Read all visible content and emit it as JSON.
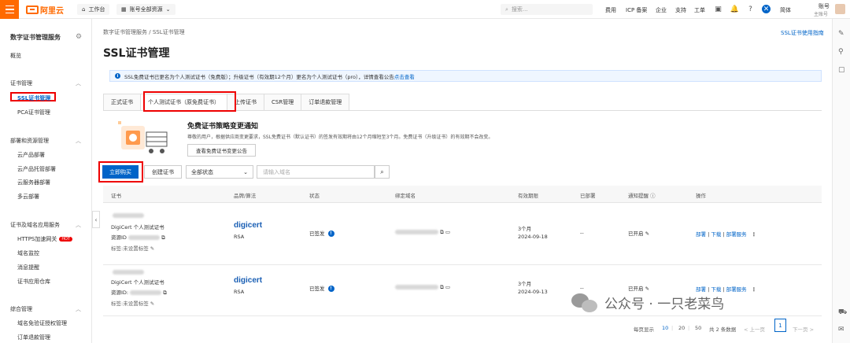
{
  "topbar": {
    "logo_text": "阿里云",
    "workbench": "工作台",
    "account_resources": "账号全部资源",
    "search_placeholder": "搜索...",
    "links": [
      "费用",
      "ICP 备案",
      "企业",
      "支持",
      "工单"
    ],
    "language": "简体",
    "user_name": "账号",
    "user_role": "主账号"
  },
  "sidebar": {
    "title": "数字证书管理服务",
    "overview": "概览",
    "groups": [
      {
        "label": "证书管理",
        "items": [
          "SSL证书管理",
          "PCA证书管理"
        ]
      },
      {
        "label": "部署和资源管理",
        "items": [
          "云产品部署",
          "云产品托管部署",
          "云服务器部署",
          "多云部署"
        ]
      },
      {
        "label": "证书及域名应用服务",
        "items": [
          "HTTPS加速网关",
          "域名监控",
          "消息提醒",
          "证书应用仓库"
        ]
      },
      {
        "label": "综合管理",
        "items": [
          "域名免验证授权管理",
          "订单退款管理"
        ]
      }
    ],
    "hot_badge": "HOT"
  },
  "main": {
    "breadcrumb": [
      "数字证书管理服务",
      "SSL证书管理"
    ],
    "title": "SSL证书管理",
    "guide_link": "SSL证书使用指南",
    "notice_text": "SSL免费证书已更名为个人测试证书（免费版）；升级证书（有效期12个月）更名为个人测试证书（pro），详情查看公告",
    "notice_link": "点击查看",
    "tabs": [
      "正式证书",
      "个人测试证书（原免费证书）",
      "上传证书",
      "CSR管理",
      "订单退款管理"
    ],
    "promo_title": "免费证书策略变更通知",
    "promo_desc": "尊敬的用户，根据供应商变更要求，SSL免费证书（默认证书）的签发有效期将由12个月缩短至3个月。免费证书（升级证书）的有效期不会改变。",
    "promo_button": "查看免费证书变更公告",
    "buy_button": "立即购买",
    "create_button": "创建证书",
    "status_select": "全部状态",
    "domain_placeholder": "请输入域名"
  },
  "table": {
    "headers": [
      "证书",
      "品牌/算法",
      "状态",
      "绑定域名",
      "有效期限",
      "已部署",
      "通知提醒",
      "操作"
    ],
    "rows": [
      {
        "cert_name": "DigiCert 个人测试证书",
        "resource_label": "资源ID",
        "tag_label": "标签:未设置标签",
        "brand": "digicert",
        "algo": "RSA",
        "status": "已签发",
        "validity": "3个月",
        "expiry": "2024-09-18",
        "deployed": "--",
        "notify": "已开启",
        "actions": [
          "部署",
          "下载",
          "部署服务"
        ]
      },
      {
        "cert_name": "DigiCert 个人测试证书",
        "resource_label": "资源ID:",
        "tag_label": "标签:未设置标签",
        "brand": "digicert",
        "algo": "RSA",
        "status": "已签发",
        "validity": "3个月",
        "expiry": "2024-09-13",
        "deployed": "--",
        "notify": "已开启",
        "actions": [
          "部署",
          "下载",
          "部署服务"
        ]
      }
    ]
  },
  "pagination": {
    "per_page_label": "每页显示",
    "sizes": [
      "10",
      "20",
      "50"
    ],
    "total": "共 2 条数据",
    "prev": "< 上一页",
    "current": "1",
    "next": "下一页 >"
  },
  "watermark": "公众号 · 一只老菜鸟",
  "colors": {
    "accent": "#ff6a00",
    "primary": "#0064c8",
    "highlight": "#e00000"
  }
}
